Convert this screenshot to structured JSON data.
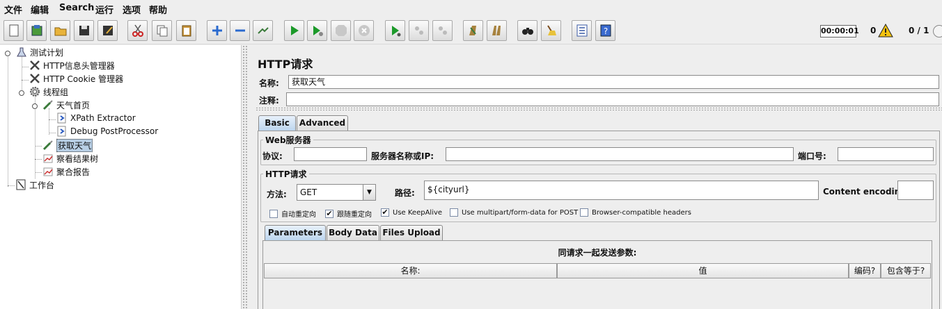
{
  "menu": [
    "文件",
    "编辑",
    "Search",
    "运行",
    "选项",
    "帮助"
  ],
  "toolbar": {
    "buttons": [
      "new-icon",
      "templates-icon",
      "open-icon",
      "save-icon",
      "save-as-icon",
      "cut-icon",
      "copy-icon",
      "paste-icon",
      "expand-icon",
      "collapse-icon",
      "toggle-icon",
      "start-icon",
      "start-no-pause-icon",
      "stop-icon",
      "shutdown-icon",
      "remote-start-icon",
      "remote-stop-icon",
      "remote-shutdown-icon",
      "clear-icon",
      "clear-all-icon",
      "search-icon",
      "reset-search-icon",
      "function-helper-icon",
      "help-icon"
    ],
    "timer": "00:00:01",
    "error_count": "0",
    "threads": "0 / 1"
  },
  "tree": {
    "nodes": [
      {
        "label": "测试计划",
        "icon": "test-plan-icon"
      },
      {
        "label": "HTTP信息头管理器",
        "icon": "config-tool-icon"
      },
      {
        "label": "HTTP Cookie 管理器",
        "icon": "config-tool-icon"
      },
      {
        "label": "线程组",
        "icon": "gear-icon"
      },
      {
        "label": "天气首页",
        "icon": "sampler-icon"
      },
      {
        "label": "XPath Extractor",
        "icon": "post-processor-icon"
      },
      {
        "label": "Debug PostProcessor",
        "icon": "post-processor-icon"
      },
      {
        "label": "获取天气",
        "icon": "sampler-icon"
      },
      {
        "label": "察看结果树",
        "icon": "listener-icon"
      },
      {
        "label": "聚合报告",
        "icon": "listener-icon"
      },
      {
        "label": "工作台",
        "icon": "workbench-icon"
      }
    ]
  },
  "panel": {
    "title": "HTTP请求",
    "name_label": "名称:",
    "name_value": "获取天气",
    "comment_label": "注释:",
    "comment_value": "",
    "tabs": [
      "Basic",
      "Advanced"
    ],
    "web_server": {
      "title": "Web服务器",
      "protocol_label": "协议:",
      "server_label": "服务器名称或IP:",
      "port_label": "端口号:"
    },
    "http_request": {
      "title": "HTTP请求",
      "method_label": "方法:",
      "method_value": "GET",
      "path_label": "路径:",
      "path_value": "${cityurl}",
      "encoding_label": "Content encoding:"
    },
    "checkboxes": [
      {
        "label": "自动重定向",
        "checked": false
      },
      {
        "label": "跟随重定向",
        "checked": true
      },
      {
        "label": "Use KeepAlive",
        "checked": true
      },
      {
        "label": "Use multipart/form-data for POST",
        "checked": false
      },
      {
        "label": "Browser-compatible headers",
        "checked": false
      }
    ],
    "param_tabs": [
      "Parameters",
      "Body Data",
      "Files Upload"
    ],
    "params_heading": "同请求一起发送参数:",
    "columns": [
      "名称:",
      "值",
      "编码?",
      "包含等于?"
    ]
  }
}
